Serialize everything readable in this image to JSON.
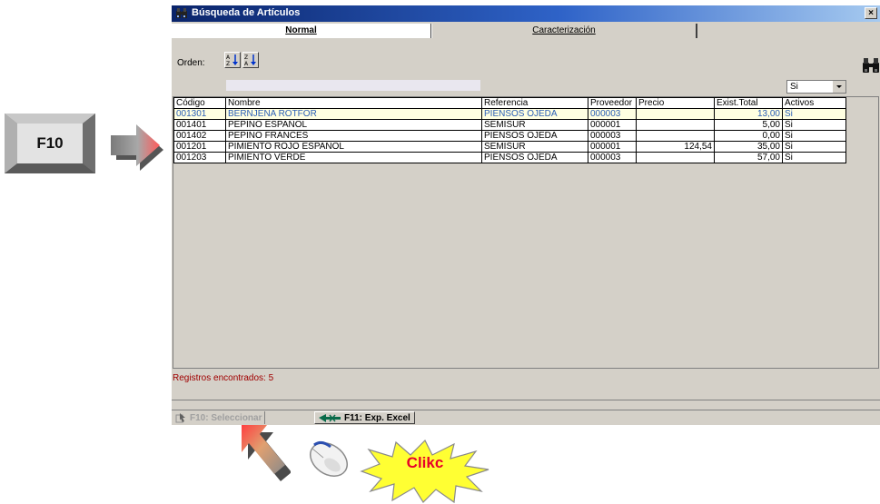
{
  "annotation": {
    "key_label": "F10",
    "click_label": "Clikc"
  },
  "window": {
    "title": "Búsqueda de Artículos",
    "close_label": "×"
  },
  "tabs": [
    {
      "label": "Normal",
      "active": true
    },
    {
      "label": "Caracterización",
      "active": false
    }
  ],
  "toolbar": {
    "orden_label": "Orden:"
  },
  "filter": {
    "activos_value": "Si"
  },
  "table": {
    "columns": [
      "Código",
      "Nombre",
      "Referencia",
      "Proveedor",
      "Precio",
      "Exist.Total",
      "Activos"
    ],
    "rows": [
      {
        "codigo": "001301",
        "nombre": "BERNJENA ROTFOR",
        "referencia": "PIENSOS OJEDA",
        "proveedor": "000003",
        "precio": "",
        "exist": "13,00",
        "activos": "Si",
        "selected": true
      },
      {
        "codigo": "001401",
        "nombre": "PEPINO ESPAÑOL",
        "referencia": "SEMISUR",
        "proveedor": "000001",
        "precio": "",
        "exist": "5,00",
        "activos": "Si"
      },
      {
        "codigo": "001402",
        "nombre": "PEPINO FRANCES",
        "referencia": "PIENSOS OJEDA",
        "proveedor": "000003",
        "precio": "",
        "exist": "0,00",
        "activos": "Si"
      },
      {
        "codigo": "001201",
        "nombre": "PIMIENTO ROJO ESPAÑOL",
        "referencia": "SEMISUR",
        "proveedor": "000001",
        "precio": "124,54",
        "exist": "35,00",
        "activos": "Si"
      },
      {
        "codigo": "001203",
        "nombre": "PIMIENTO VERDE",
        "referencia": "PIENSOS OJEDA",
        "proveedor": "000003",
        "precio": "",
        "exist": "57,00",
        "activos": "Si"
      }
    ]
  },
  "status": {
    "text": "Registros encontrados: 5"
  },
  "bottombar": {
    "select_label": "F10: Seleccionar",
    "excel_label": "F11: Exp. Excel"
  },
  "colors": {
    "title_bar": "#0a246a",
    "selected_row_text": "#2b5fb5",
    "status_text": "#a00000",
    "click_text": "#e8002a",
    "burst_fill": "#ffff33"
  }
}
